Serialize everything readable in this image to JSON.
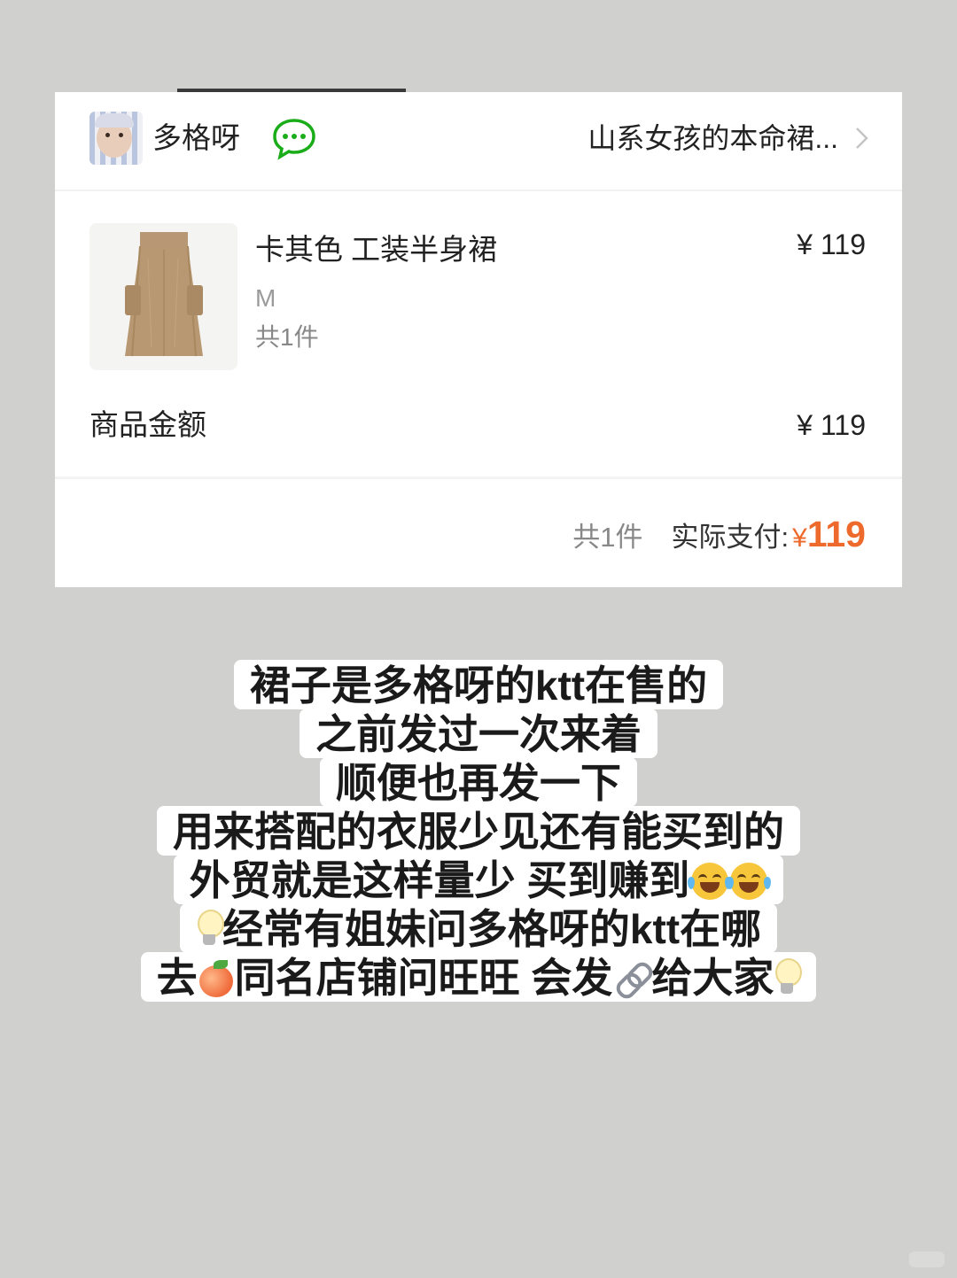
{
  "shop": {
    "name": "多格呀",
    "promo_title": "山系女孩的本命裙..."
  },
  "product": {
    "name": "卡其色 工装半身裙",
    "price": "¥ 119",
    "spec": "M",
    "quantity": "共1件"
  },
  "summary": {
    "amount_label": "商品金额",
    "amount_value": "¥ 119",
    "total_count": "共1件",
    "paid_label": "实际支付:",
    "currency": "¥",
    "paid_value": "119"
  },
  "caption": {
    "line1": "裙子是多格呀的ktt在售的",
    "line2": "之前发过一次来着",
    "line3": "顺便也再发一下",
    "line4": "用来搭配的衣服少见还有能买到的",
    "line5": "外贸就是这样量少 买到赚到",
    "line6": "经常有姐妹问多格呀的ktt在哪",
    "line7a": "去",
    "line7b": "同名店铺问旺旺 会发",
    "line7c": "给大家"
  },
  "colors": {
    "accent_orange": "#ee6a2c",
    "wechat_green": "#1aad19",
    "background": "#d0d0cf"
  },
  "icons": {
    "chat": "chat-bubble-icon",
    "chevron": "chevron-right-icon",
    "laugh": "tears-of-joy-emoji",
    "bulb": "light-bulb-emoji",
    "peach": "peach-emoji",
    "link": "link-emoji"
  }
}
